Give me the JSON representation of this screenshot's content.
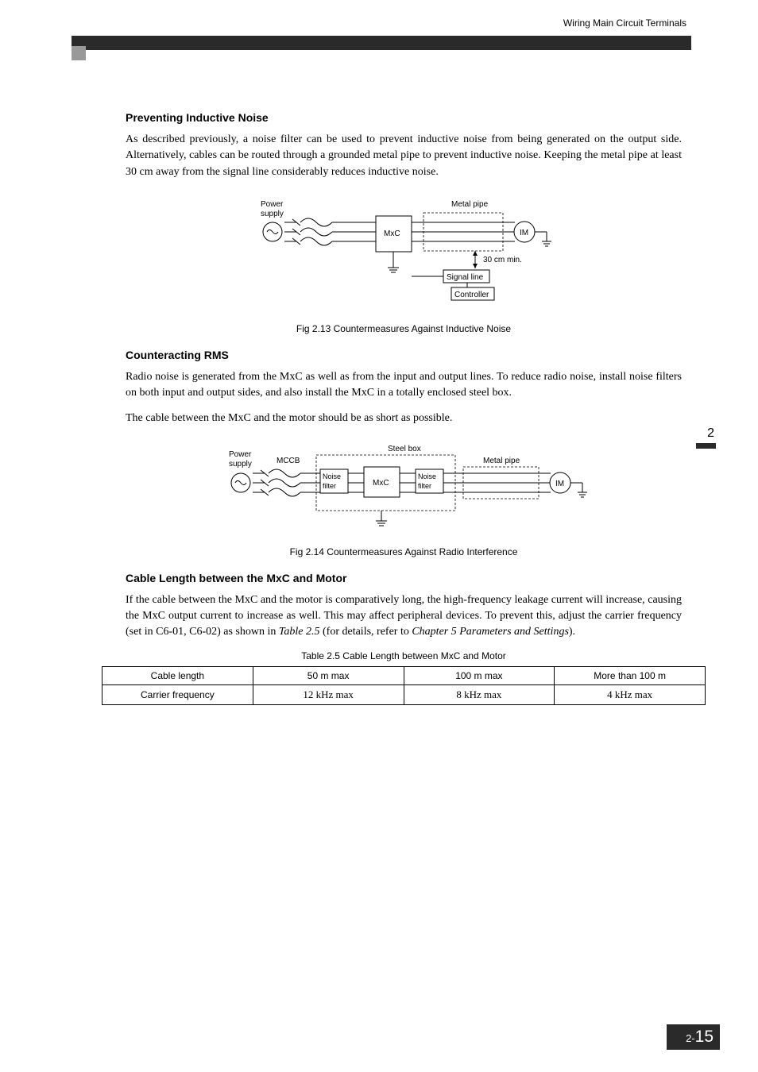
{
  "header": {
    "section": "Wiring Main Circuit Terminals"
  },
  "sections": {
    "s1": {
      "title": "Preventing Inductive Noise",
      "p1": "As described previously, a noise filter can be used to prevent inductive noise from being generated on the output side. Alternatively, cables can be routed through a grounded metal pipe to prevent inductive noise. Keeping the metal pipe at least 30 cm away from the signal line considerably reduces inductive noise."
    },
    "fig1": {
      "labels": {
        "power_supply1": "Power",
        "power_supply2": "supply",
        "mxc": "MxC",
        "metal_pipe": "Metal pipe",
        "im": "IM",
        "distance": "30 cm min.",
        "signal_line": "Signal line",
        "controller": "Controller"
      },
      "caption": "Fig 2.13  Countermeasures Against Inductive Noise"
    },
    "s2": {
      "title": "Counteracting RMS",
      "p1": "Radio noise is generated from the MxC as well as from the input and output lines. To reduce radio noise, install noise filters on both input and output sides, and also install the MxC in a totally enclosed steel box.",
      "p2": "The cable between the MxC and the motor should be as short as possible."
    },
    "fig2": {
      "labels": {
        "power_supply1": "Power",
        "power_supply2": "supply",
        "mccb": "MCCB",
        "steel_box": "Steel box",
        "noise_filter1a": "Noise",
        "noise_filter1b": "filter",
        "mxc": "MxC",
        "noise_filter2a": "Noise",
        "noise_filter2b": "filter",
        "metal_pipe": "Metal pipe",
        "im": "IM"
      },
      "caption": "Fig 2.14  Countermeasures Against Radio Interference"
    },
    "s3": {
      "title": "Cable Length between the MxC and Motor",
      "p1_a": "If the cable between the MxC and the motor is comparatively long, the high-frequency leakage current will increase, causing the MxC output current to increase as well. This may affect peripheral devices. To prevent this, adjust the carrier frequency (set in C6-01, C6-02) as shown in ",
      "p1_b": "Table 2.5",
      "p1_c": " (for details, refer to ",
      "p1_d": "Chapter 5 Parameters and Settings",
      "p1_e": ")."
    },
    "table": {
      "caption": "Table 2.5  Cable Length between MxC and Motor",
      "r1c1": "Cable length",
      "r1c2": "50 m max",
      "r1c3": "100 m max",
      "r1c4": "More than 100 m",
      "r2c1": "Carrier frequency",
      "r2c2": "12 kHz max",
      "r2c3": "8 kHz max",
      "r2c4": "4 kHz max"
    }
  },
  "side": {
    "chapter": "2"
  },
  "footer": {
    "prefix": "2-",
    "page": "15"
  }
}
